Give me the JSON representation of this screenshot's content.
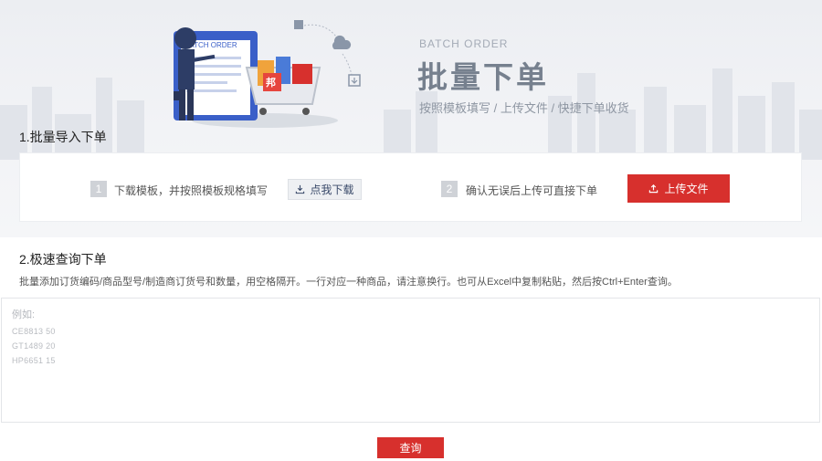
{
  "hero": {
    "english_title": "BATCH ORDER",
    "title": "批量下单",
    "subtitle": "按照模板填写 / 上传文件 / 快捷下单收货",
    "illustration_clipboard_text": "BATCH ORDER",
    "illustration_tag_text": "邦"
  },
  "section1": {
    "title": "1.批量导入下单",
    "step1": {
      "number": "1",
      "text": "下载模板，并按照模板规格填写",
      "button_label": "点我下载"
    },
    "step2": {
      "number": "2",
      "text": "确认无误后上传可直接下单",
      "button_label": "上传文件"
    }
  },
  "section2": {
    "title": "2.极速查询下单",
    "instruction": "批量添加订货编码/商品型号/制造商订货号和数量，用空格隔开。一行对应一种商品，请注意换行。也可从Excel中复制粘贴，然后按Ctrl+Enter查询。",
    "placeholder_label": "例如:",
    "placeholder_lines": [
      "CE8813  50",
      "GT1489  20",
      "HP6651  15"
    ],
    "query_button_label": "查询"
  },
  "colors": {
    "accent_red": "#d7302d",
    "hero_bg": "#eceef2",
    "title_gray": "#76808e"
  }
}
